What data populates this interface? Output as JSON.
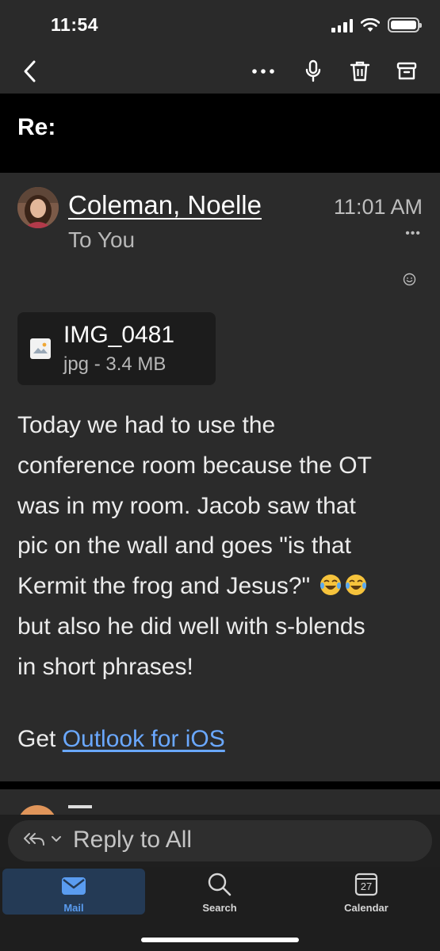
{
  "status_bar": {
    "time": "11:54"
  },
  "toolbar": {
    "back_icon": "chevron-left-icon",
    "more_icon": "ellipsis-icon",
    "mic_icon": "microphone-icon",
    "delete_icon": "trash-icon",
    "archive_icon": "archive-icon"
  },
  "email": {
    "subject": "Re:",
    "sender": "Coleman, Noelle",
    "time": "11:01 AM",
    "recipients": "To You",
    "more": "•••",
    "attachment": {
      "name": "IMG_0481",
      "meta": "jpg - 3.4 MB"
    },
    "body_lines": [
      "Today we had to use the",
      "conference room because the OT",
      "was in my room. Jacob saw that",
      "pic on the wall and goes \"is that",
      "Kermit the frog and Jesus?\"",
      "but also he did well with s-blends",
      "in short phrases!"
    ],
    "signature_prefix": "Get ",
    "signature_link": "Outlook for iOS"
  },
  "reply": {
    "label": "Reply to All"
  },
  "tabs": [
    {
      "label": "Mail",
      "icon": "mail-icon",
      "active": true
    },
    {
      "label": "Search",
      "icon": "search-icon",
      "active": false
    },
    {
      "label": "Calendar",
      "icon": "calendar-icon",
      "active": false,
      "badge": "27"
    }
  ],
  "colors": {
    "accent": "#5a9cf0",
    "link": "#6aa8ff",
    "background": "#2b2b2b"
  }
}
